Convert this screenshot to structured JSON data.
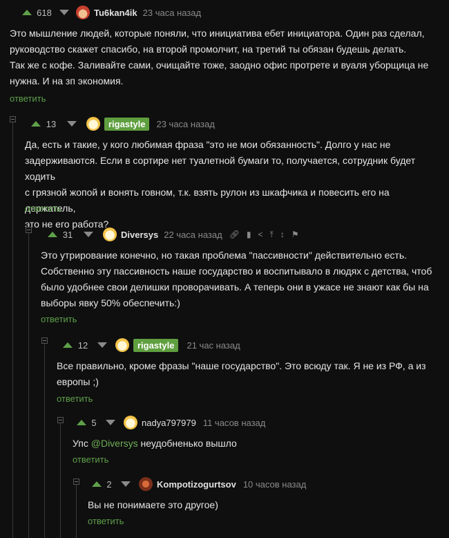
{
  "comments": [
    {
      "rating": "618",
      "author": "Tu6kan4ik",
      "time": "23 часа назад",
      "lines": [
        "Это мышление людей, которые поняли, что инициатива ебет инициатора. Один раз сделал,",
        "руководство скажет спасибо, на второй промолчит, на третий ты обязан будешь делать.",
        "Так же с кофе. Заливайте сами, очищайте тоже, заодно офис протрете и вуаля уборщица не",
        "нужна. И на зп экономия."
      ],
      "reply": "ответить"
    },
    {
      "rating": "13",
      "author": "rigastyle",
      "time": "23 часа назад",
      "lines": [
        "Да, есть и такие, у кого любимая фраза \"это не мои обязанность\". Долго у нас не",
        "задерживаются. Если в сортире нет туалетной бумаги то, получается, сотрудник будет ходить",
        "с грязной жопой и вонять говном, т.к. взять рулон из шкафчика и повесить его на держатель,",
        "это не его работа?"
      ],
      "reply": "ответить"
    },
    {
      "rating": "31",
      "author": "Diversys",
      "time": "22 часа назад",
      "lines": [
        "Это утрирование конечно, но такая проблема \"пассивности\" действительно есть.",
        "Собственно эту пассивность наше государство и воспитывало в людях с детства, чтоб",
        "было удобнее свои делишки проворачивать. А теперь они в ужасе не знают как бы на",
        "выборы явку  50% обеспечить:)"
      ],
      "reply": "ответить"
    },
    {
      "rating": "12",
      "author": "rigastyle",
      "time": "21 час назад",
      "lines": [
        "Все правильно, кроме фразы \"наше государство\". Это всюду так. Я не из РФ, а из",
        "европы ;)"
      ],
      "reply": "ответить"
    },
    {
      "rating": "5",
      "author": "nadya797979",
      "time": "11 часов назад",
      "text_prefix": "Упс ",
      "mention": "@Diversys",
      "text_suffix": " неудобненько вышло",
      "reply": "ответить"
    },
    {
      "rating": "2",
      "author": "Kompotizogurtsov",
      "time": "10 часов назад",
      "lines": [
        "Вы не понимаете это другое)"
      ],
      "reply": "ответить"
    }
  ],
  "icons": {
    "up": "upvote-arrow-icon",
    "down": "downvote-arrow-icon",
    "tools": [
      "link-icon",
      "save-icon",
      "share-icon",
      "pin-icon",
      "branch-icon",
      "flag-icon"
    ]
  },
  "colors": {
    "accent": "#5ea04a",
    "background": "#0f0f0f",
    "muted": "#8a8a8a"
  }
}
